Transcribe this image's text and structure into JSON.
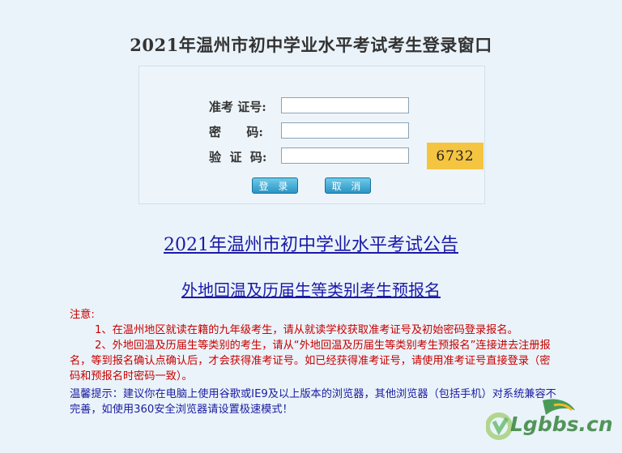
{
  "page": {
    "title": "2021年温州市初中学业水平考试考生登录窗口"
  },
  "login_form": {
    "exam_id_label": "准考 证号:",
    "exam_id_value": "",
    "password_label": "密      码:",
    "password_value": "",
    "captcha_label": "验  证  码:",
    "captcha_value": "",
    "captcha_code": "6732",
    "login_button": "登 录",
    "cancel_button": "取 消"
  },
  "links": {
    "announcement": "2021年温州市初中学业水平考试公告",
    "pre_registration": "外地回温及历届生等类别考生预报名"
  },
  "notice": {
    "heading": "注意:",
    "item1": "1、在温州地区就读在籍的九年级考生，请从就读学校获取准考证号及初始密码登录报名。",
    "item2": "2、外地回温及历届生等类别的考生，请从“外地回温及历届生等类别考生预报名”连接进去注册报名，等到报名确认点确认后，才会获得准考证号。如已经获得准考证号，请使用准考证号直接登录（密码和预报名时密码一致）。",
    "tip": "温馨提示：建议你在电脑上使用谷歌或IE9及以上版本的浏览器，其他浏览器（包括手机）对系统兼容不完善，如使用360安全浏览器请设置极速模式！"
  },
  "watermark": {
    "text": "Lgbbs.cn"
  },
  "colors": {
    "background": "#eaf3f9",
    "link": "#1a1aa8",
    "notice_red": "#c80000",
    "captcha_bg": "#f5c542",
    "button": "#2a94c4"
  }
}
